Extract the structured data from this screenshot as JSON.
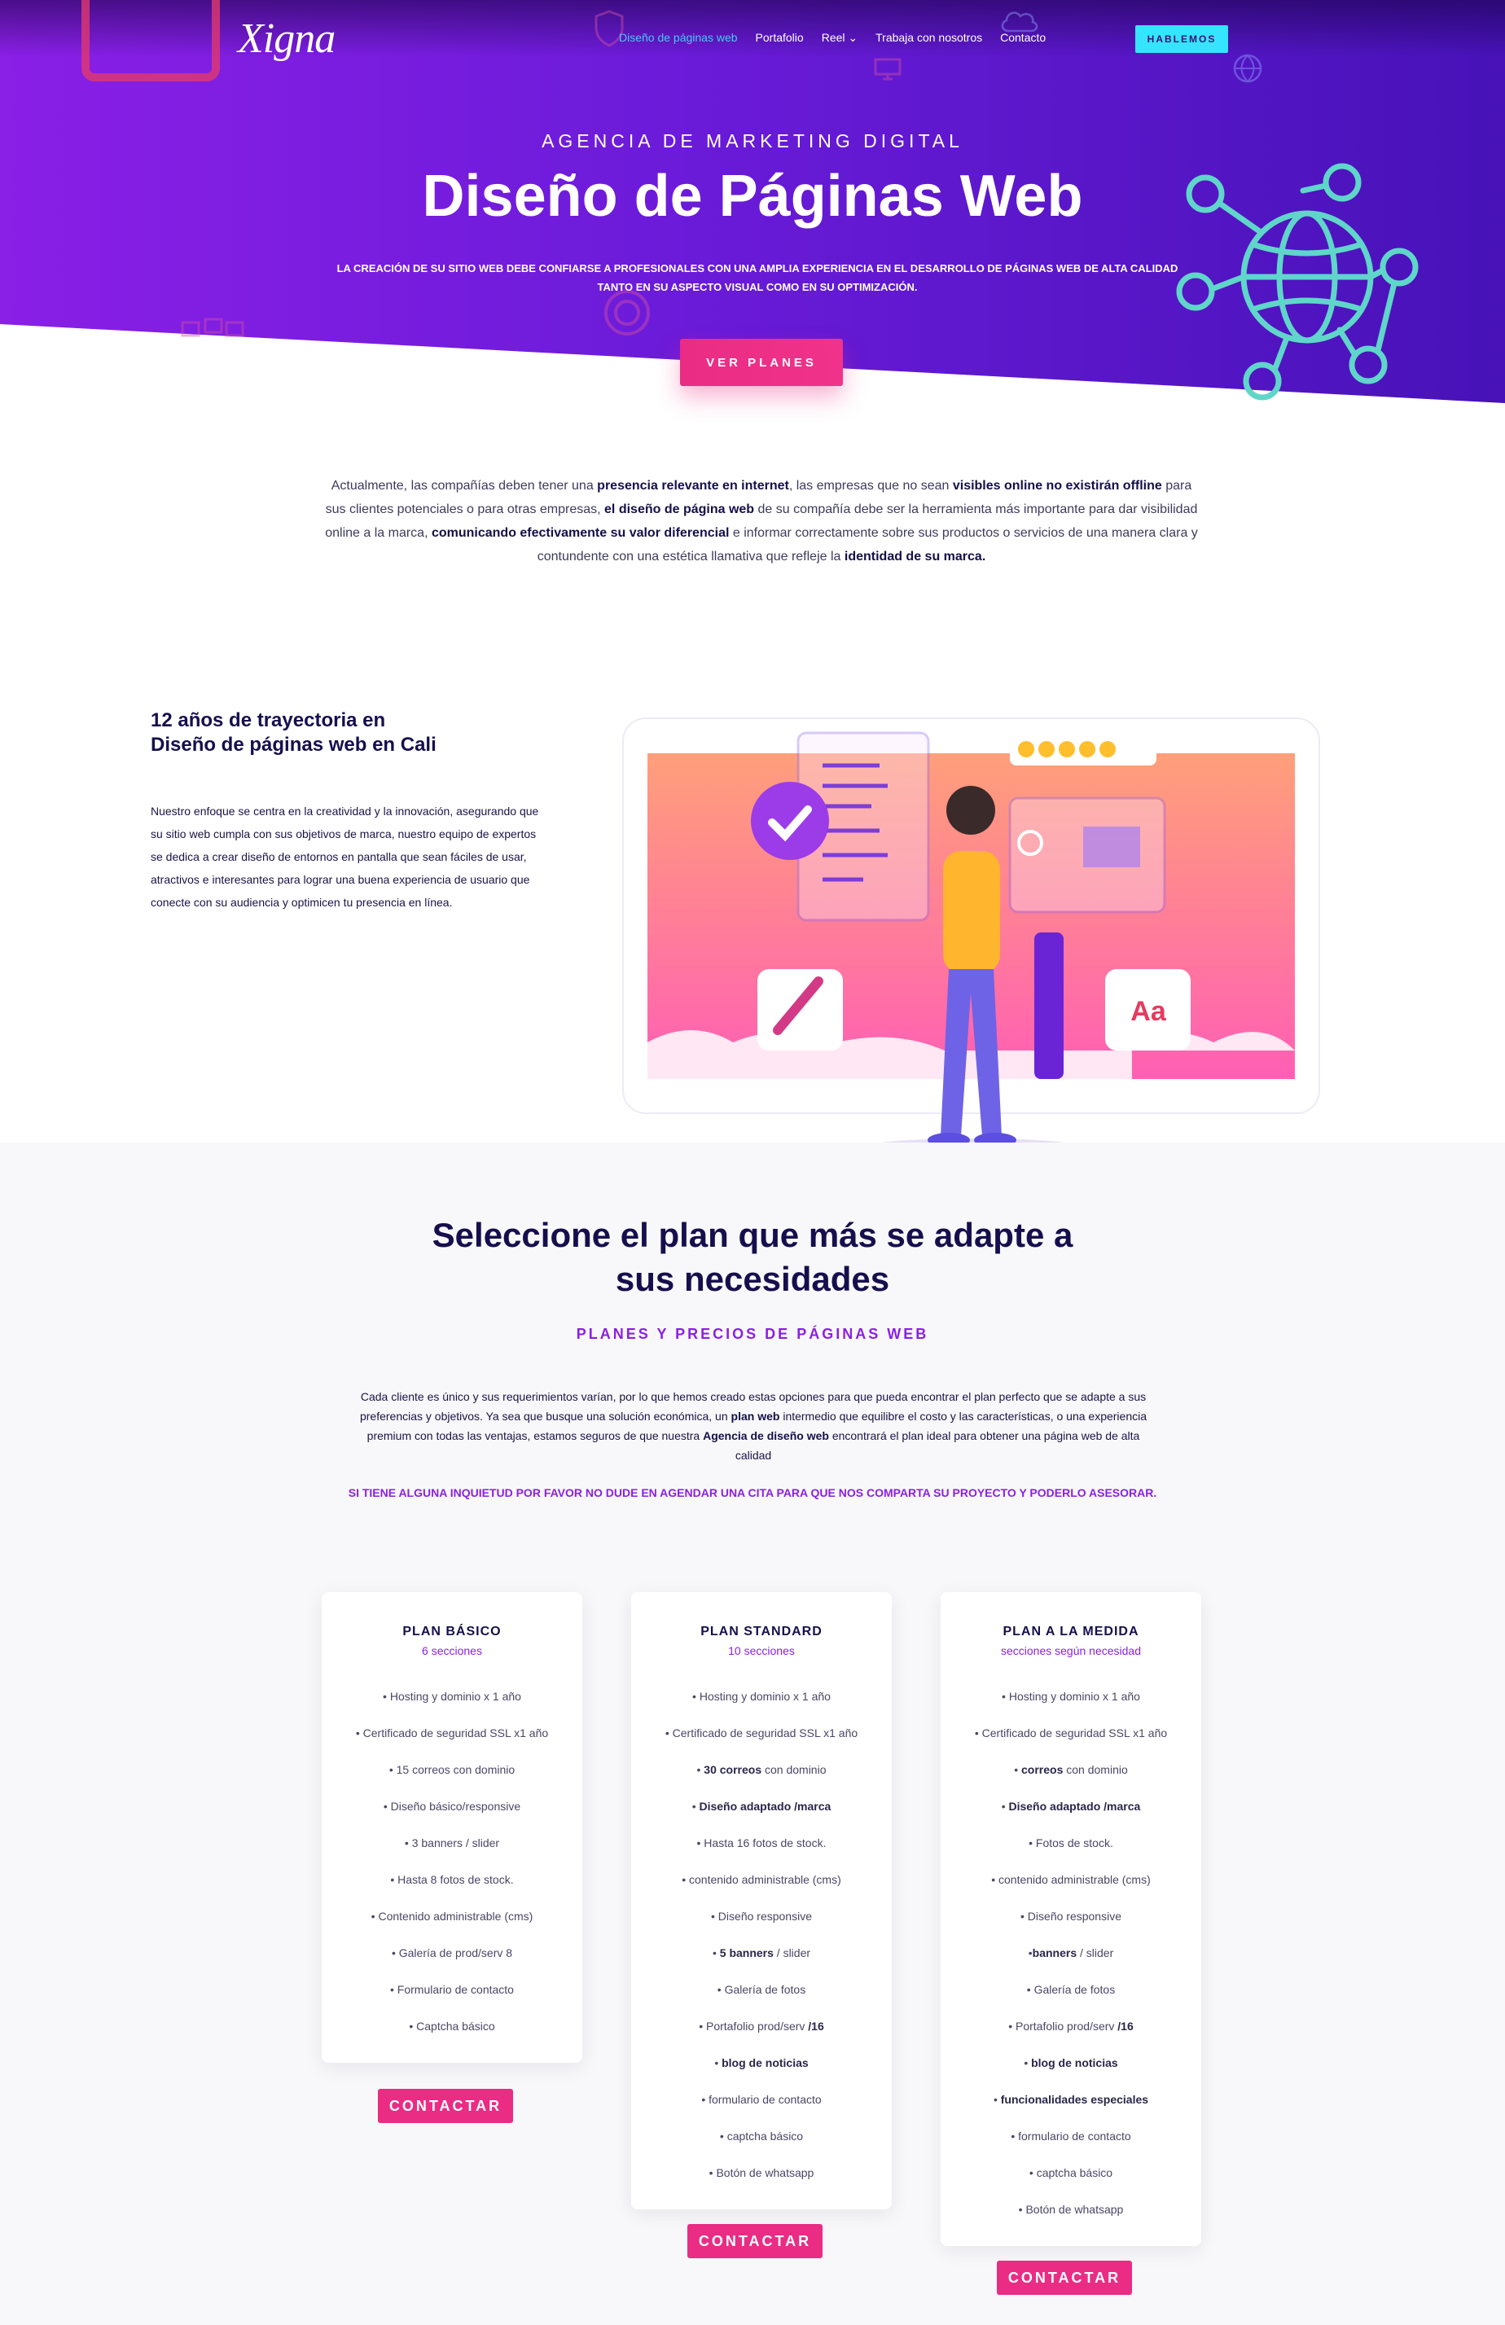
{
  "header": {
    "logo": "Xigna",
    "nav": [
      {
        "label": "Diseño de páginas web",
        "active": true
      },
      {
        "label": "Portafolio",
        "active": false
      },
      {
        "label": "Reel ⌄",
        "active": false
      },
      {
        "label": "Trabaja con nosotros",
        "active": false
      },
      {
        "label": "Contacto",
        "active": false
      }
    ],
    "cta_label": "HABLEMOS"
  },
  "hero": {
    "eyebrow": "AGENCIA DE MARKETING DIGITAL",
    "title": "Diseño de Páginas Web",
    "description": "LA CREACIÓN DE SU SITIO WEB DEBE CONFIARSE A PROFESIONALES CON UNA AMPLIA EXPERIENCIA EN EL DESARROLLO DE PÁGINAS WEB DE ALTA CALIDAD TANTO EN SU ASPECTO VISUAL COMO EN SU OPTIMIZACIÓN.",
    "button_label": "VER PLANES"
  },
  "intro": {
    "parts": [
      {
        "text": "Actualmente, las compañías deben tener una ",
        "bold": false
      },
      {
        "text": "presencia relevante en internet",
        "bold": true
      },
      {
        "text": ", las empresas que no sean ",
        "bold": false
      },
      {
        "text": "visibles online no existirán offline",
        "bold": true
      },
      {
        "text": " para sus clientes potenciales o para otras empresas, ",
        "bold": false
      },
      {
        "text": "el diseño de página web",
        "bold": true
      },
      {
        "text": " de su compañía debe ser la herramienta más importante para dar visibilidad online a la marca, ",
        "bold": false
      },
      {
        "text": "comunicando efectivamente su valor diferencial",
        "bold": true
      },
      {
        "text": " e informar correctamente sobre sus productos o servicios de una manera clara y contundente con una estética llamativa que refleje la ",
        "bold": false
      },
      {
        "text": "identidad de su marca.",
        "bold": true
      }
    ]
  },
  "experience": {
    "title_line1": "12 años de trayectoria en",
    "title_line2": "Diseño de páginas web en Cali",
    "text": "Nuestro enfoque se centra en la creatividad y la innovación, asegurando que su sitio web cumpla con sus objetivos de marca, nuestro equipo de expertos se dedica a crear diseño de entornos en pantalla que sean fáciles de usar, atractivos e interesantes para lograr una buena experiencia de usuario que conecte con su audiencia y optimicen tu presencia en línea.",
    "illustration_text": "Aa"
  },
  "plans": {
    "title_line1": "Seleccione el plan que más se adapte a",
    "title_line2": "sus necesidades",
    "subtitle": "PLANES Y PRECIOS DE PÁGINAS WEB",
    "description_parts": [
      {
        "text": "Cada cliente es único y sus requerimientos varían, por lo que hemos creado estas opciones para que pueda encontrar el plan perfecto que se adapte a sus preferencias y objetivos. Ya sea que busque una solución económica, un ",
        "bold": false
      },
      {
        "text": "plan web",
        "bold": true
      },
      {
        "text": " intermedio que equilibre el costo y las características, o una experiencia premium con todas las ventajas, estamos seguros de que nuestra ",
        "bold": false
      },
      {
        "text": "Agencia de diseño web",
        "bold": true
      },
      {
        "text": " encontrará el plan ideal para obtener una página web de alta calidad",
        "bold": false
      }
    ],
    "note": "SI TIENE ALGUNA INQUIETUD POR FAVOR NO DUDE EN AGENDAR UNA CITA PARA QUE NOS COMPARTA SU PROYECTO Y PODERLO ASESORAR.",
    "button_label": "CONTACTAR",
    "cards": [
      {
        "title": "PLAN BÁSICO",
        "subtitle": "6 secciones",
        "features": [
          [
            {
              "t": "• Hosting y dominio x 1 año"
            }
          ],
          [
            {
              "t": "• Certificado de seguridad SSL x1 año"
            }
          ],
          [
            {
              "t": "• 15 correos con dominio"
            }
          ],
          [
            {
              "t": "• Diseño básico/responsive"
            }
          ],
          [
            {
              "t": "• 3 banners / slider"
            }
          ],
          [
            {
              "t": "• Hasta 8 fotos de stock."
            }
          ],
          [
            {
              "t": "• Contenido administrable (cms)"
            }
          ],
          [
            {
              "t": "• Galería de prod/serv 8"
            }
          ],
          [
            {
              "t": "• Formulario de contacto"
            }
          ],
          [
            {
              "t": "• Captcha básico"
            }
          ]
        ]
      },
      {
        "title": "PLAN STANDARD",
        "subtitle": "10 secciones",
        "features": [
          [
            {
              "t": "• Hosting y dominio x 1 año"
            }
          ],
          [
            {
              "t": "• Certificado de seguridad SSL x1 año"
            }
          ],
          [
            {
              "t": "• "
            },
            {
              "t": "30 correos",
              "b": true
            },
            {
              "t": " con dominio"
            }
          ],
          [
            {
              "t": "• "
            },
            {
              "t": "Diseño adaptado /marca",
              "b": true
            }
          ],
          [
            {
              "t": "• Hasta 16 fotos de stock."
            }
          ],
          [
            {
              "t": "• contenido administrable (cms)"
            }
          ],
          [
            {
              "t": "• Diseño responsive"
            }
          ],
          [
            {
              "t": "• "
            },
            {
              "t": "5 banners",
              "b": true
            },
            {
              "t": " / slider"
            }
          ],
          [
            {
              "t": "• Galería de fotos"
            }
          ],
          [
            {
              "t": "• Portafolio prod/serv "
            },
            {
              "t": "/16",
              "b": true
            }
          ],
          [
            {
              "t": "• "
            },
            {
              "t": "blog de noticias",
              "b": true
            }
          ],
          [
            {
              "t": "• formulario de contacto"
            }
          ],
          [
            {
              "t": "• captcha básico"
            }
          ],
          [
            {
              "t": "• Botón de whatsapp"
            }
          ]
        ]
      },
      {
        "title": "PLAN A LA MEDIDA",
        "subtitle": "secciones según necesidad",
        "features": [
          [
            {
              "t": "• Hosting y dominio x 1 año"
            }
          ],
          [
            {
              "t": "• Certificado de seguridad SSL x1 año"
            }
          ],
          [
            {
              "t": "• "
            },
            {
              "t": "correos",
              "b": true
            },
            {
              "t": " con dominio"
            }
          ],
          [
            {
              "t": "• "
            },
            {
              "t": "Diseño adaptado /marca",
              "b": true
            }
          ],
          [
            {
              "t": "• Fotos de stock."
            }
          ],
          [
            {
              "t": "• contenido administrable (cms)"
            }
          ],
          [
            {
              "t": "• Diseño responsive"
            }
          ],
          [
            {
              "t": "•"
            },
            {
              "t": "banners",
              "b": true
            },
            {
              "t": " / slider"
            }
          ],
          [
            {
              "t": "• Galería de fotos"
            }
          ],
          [
            {
              "t": "• Portafolio prod/serv "
            },
            {
              "t": "/16",
              "b": true
            }
          ],
          [
            {
              "t": "• "
            },
            {
              "t": "blog de noticias",
              "b": true
            }
          ],
          [
            {
              "t": "• "
            },
            {
              "t": "funcionalidades especiales",
              "b": true
            }
          ],
          [
            {
              "t": "• formulario de contacto"
            }
          ],
          [
            {
              "t": "• captcha básico"
            }
          ],
          [
            {
              "t": "• Botón de whatsapp"
            }
          ]
        ]
      }
    ]
  },
  "colors": {
    "brand_purple": "#8a1fe6",
    "accent_pink": "#ea2c84",
    "accent_cyan": "#35e5ff",
    "navy_text": "#160f4d"
  }
}
